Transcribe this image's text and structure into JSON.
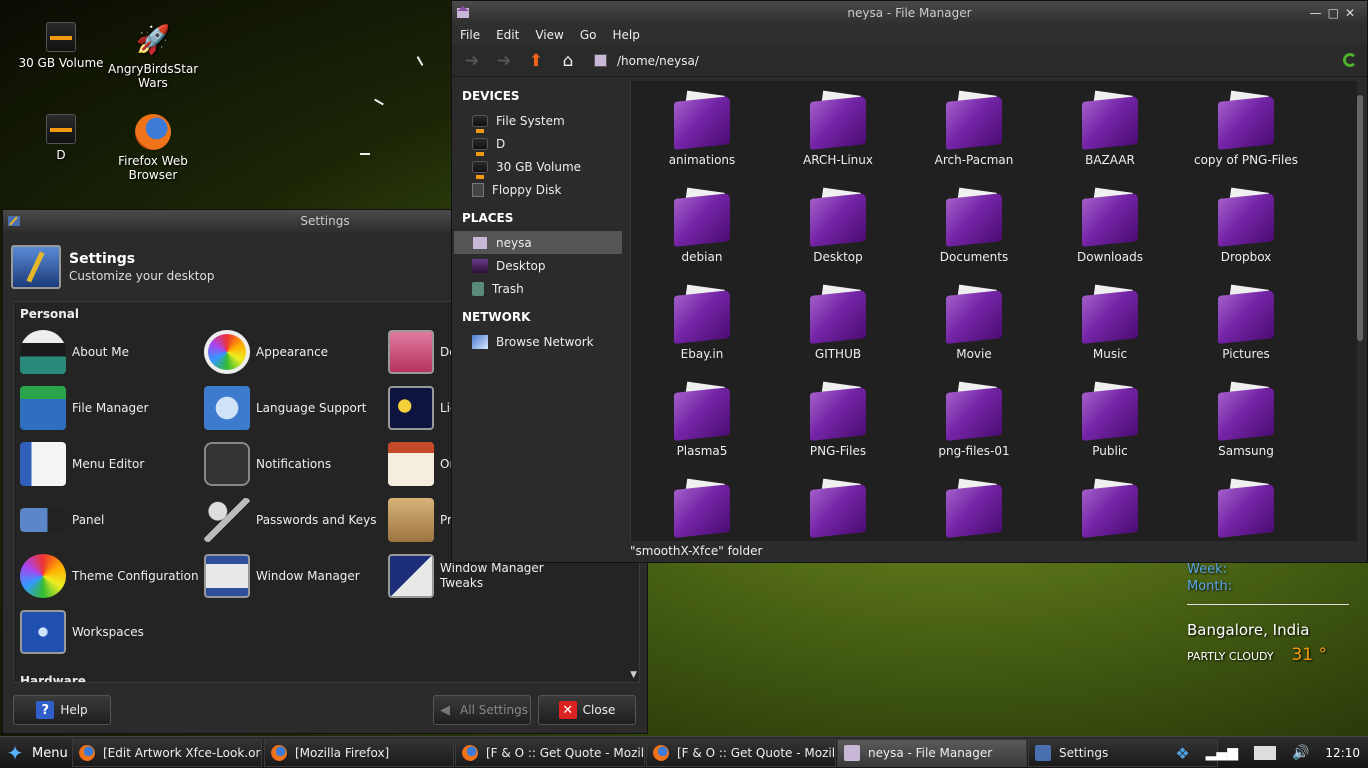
{
  "desktop": {
    "icons": [
      {
        "label": "30 GB Volume"
      },
      {
        "label": "AngryBirdsStar Wars"
      },
      {
        "label": "D"
      },
      {
        "label": "Firefox Web Browser"
      }
    ]
  },
  "weather": {
    "week_label": "Week:",
    "month_label": "Month:",
    "city": "Bangalore, India",
    "condition": "PARTLY CLOUDY",
    "temperature": "31 °"
  },
  "settings": {
    "window_title": "Settings",
    "header_title": "Settings",
    "header_subtitle": "Customize your desktop",
    "section_personal": "Personal",
    "section_hardware": "Hardware",
    "items": [
      {
        "label": "About Me",
        "icon": "person-icon"
      },
      {
        "label": "Appearance",
        "icon": "palette-icon"
      },
      {
        "label": "De",
        "icon": "desktop-tulip-icon"
      },
      {
        "label": "File Manager",
        "icon": "file-cabinet-icon"
      },
      {
        "label": "Language Support",
        "icon": "globe-icon"
      },
      {
        "label": "Lig",
        "icon": "night-moon-icon"
      },
      {
        "label": "Menu Editor",
        "icon": "menu-editor-icon"
      },
      {
        "label": "Notifications",
        "icon": "notification-icon"
      },
      {
        "label": "Or",
        "icon": "calendar-icon"
      },
      {
        "label": "Panel",
        "icon": "panel-icon"
      },
      {
        "label": "Passwords and Keys",
        "icon": "keys-icon"
      },
      {
        "label": "Pr",
        "icon": "package-star-icon"
      },
      {
        "label": "Theme Configuration",
        "icon": "color-wheel-icon"
      },
      {
        "label": "Window Manager",
        "icon": "window-manager-icon"
      },
      {
        "label": "Window Manager Tweaks",
        "icon": "window-tweaks-icon"
      },
      {
        "label": "Workspaces",
        "icon": "workspaces-icon"
      }
    ],
    "help_label": "Help",
    "all_settings_label": "All Settings",
    "close_label": "Close"
  },
  "file_manager": {
    "window_title": "neysa - File Manager",
    "menu": [
      "File",
      "Edit",
      "View",
      "Go",
      "Help"
    ],
    "path": "/home/neysa/",
    "devices_header": "DEVICES",
    "devices": [
      "File System",
      "D",
      "30 GB Volume",
      "Floppy Disk"
    ],
    "places_header": "PLACES",
    "places": [
      "neysa",
      "Desktop",
      "Trash"
    ],
    "network_header": "NETWORK",
    "network": [
      "Browse Network"
    ],
    "files": [
      {
        "label": "animations"
      },
      {
        "label": "ARCH-Linux"
      },
      {
        "label": "Arch-Pacman"
      },
      {
        "label": "BAZAAR"
      },
      {
        "label": "copy of PNG-Files"
      },
      {
        "label": "debian"
      },
      {
        "label": "Desktop"
      },
      {
        "label": "Documents"
      },
      {
        "label": "Downloads"
      },
      {
        "label": "Dropbox"
      },
      {
        "label": "Ebay.in"
      },
      {
        "label": "GITHUB"
      },
      {
        "label": "Movie"
      },
      {
        "label": "Music"
      },
      {
        "label": "Pictures"
      },
      {
        "label": "Plasma5"
      },
      {
        "label": "PNG-Files"
      },
      {
        "label": "png-files-01"
      },
      {
        "label": "Public"
      },
      {
        "label": "Samsung"
      },
      {
        "label": ""
      },
      {
        "label": ""
      },
      {
        "label": ""
      },
      {
        "label": ""
      },
      {
        "label": ""
      }
    ],
    "status": "\"smoothX-Xfce\" folder"
  },
  "taskbar": {
    "menu_label": "Menu",
    "tasks": [
      {
        "label": "[Edit  Artwork Xfce-Look.org - ..."
      },
      {
        "label": "[Mozilla Firefox]"
      },
      {
        "label": "[F & O :: Get Quote - Mozilla ..."
      },
      {
        "label": "[F & O :: Get Quote - Mozilla ..."
      },
      {
        "label": "neysa - File Manager"
      },
      {
        "label": "Settings"
      }
    ],
    "clock": "12:10"
  },
  "colors": {
    "accent": "#f29a0e",
    "folder_purple": "#7424a6",
    "link_blue": "#5ba6e5"
  }
}
